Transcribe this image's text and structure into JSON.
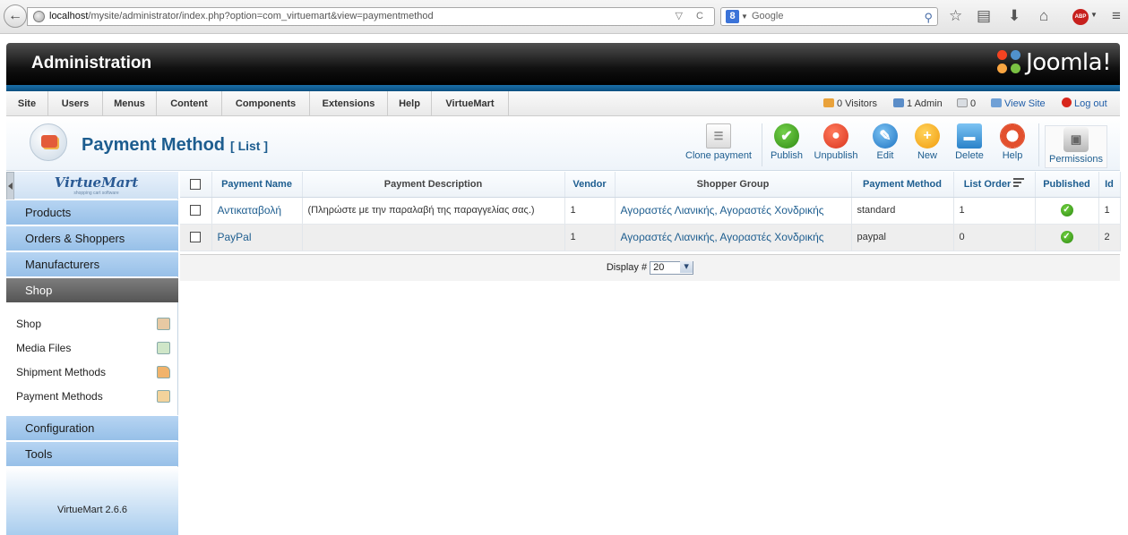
{
  "browser": {
    "url_host": "localhost",
    "url_path": "/mysite/administrator/index.php?option=com_virtuemart&view=paymentmethod",
    "search_placeholder": "Google",
    "search_engine_letter": "8"
  },
  "header": {
    "title": "Administration",
    "brand": "Joomla!"
  },
  "menu": {
    "items": [
      "Site",
      "Users",
      "Menus",
      "Content",
      "Components",
      "Extensions",
      "Help",
      "VirtueMart"
    ]
  },
  "status": {
    "visitors": "0 Visitors",
    "admins": "1 Admin",
    "messages": "0",
    "view_site": "View Site",
    "logout": "Log out"
  },
  "toolbar": {
    "title": "Payment Method",
    "subtitle": "[ List ]",
    "buttons": {
      "clone": "Clone payment",
      "publish": "Publish",
      "unpublish": "Unpublish",
      "edit": "Edit",
      "new": "New",
      "delete": "Delete",
      "help": "Help",
      "permissions": "Permissions"
    }
  },
  "sidebar": {
    "logo": "VirtueMart",
    "logo_sub": "shopping cart software",
    "sections": [
      "Products",
      "Orders & Shoppers",
      "Manufacturers",
      "Shop"
    ],
    "shop_items": [
      "Shop",
      "Media Files",
      "Shipment Methods",
      "Payment Methods"
    ],
    "bottom_sections": [
      "Configuration",
      "Tools"
    ],
    "version": "VirtueMart 2.6.6"
  },
  "table": {
    "headers": {
      "name": "Payment Name",
      "description": "Payment Description",
      "vendor": "Vendor",
      "shopper_group": "Shopper Group",
      "method": "Payment Method",
      "order": "List Order",
      "published": "Published",
      "id": "Id"
    },
    "rows": [
      {
        "name": "Αντικαταβολή",
        "description": "(Πληρώστε με την παραλαβή της παραγγελίας σας.)",
        "vendor": "1",
        "shopper_group": "Αγοραστές Λιανικής, Αγοραστές Χονδρικής",
        "method": "standard",
        "order": "1",
        "published": true,
        "id": "1"
      },
      {
        "name": "PayPal",
        "description": "",
        "vendor": "1",
        "shopper_group": "Αγοραστές Λιανικής, Αγοραστές Χονδρικής",
        "method": "paypal",
        "order": "0",
        "published": true,
        "id": "2"
      }
    ]
  },
  "pager": {
    "label": "Display #",
    "value": "20"
  },
  "colors": {
    "link": "#1d5d8f",
    "accent_blue": "#1a6fa8",
    "publish_green": "#2f8b12",
    "unpublish_red": "#d9341d"
  }
}
